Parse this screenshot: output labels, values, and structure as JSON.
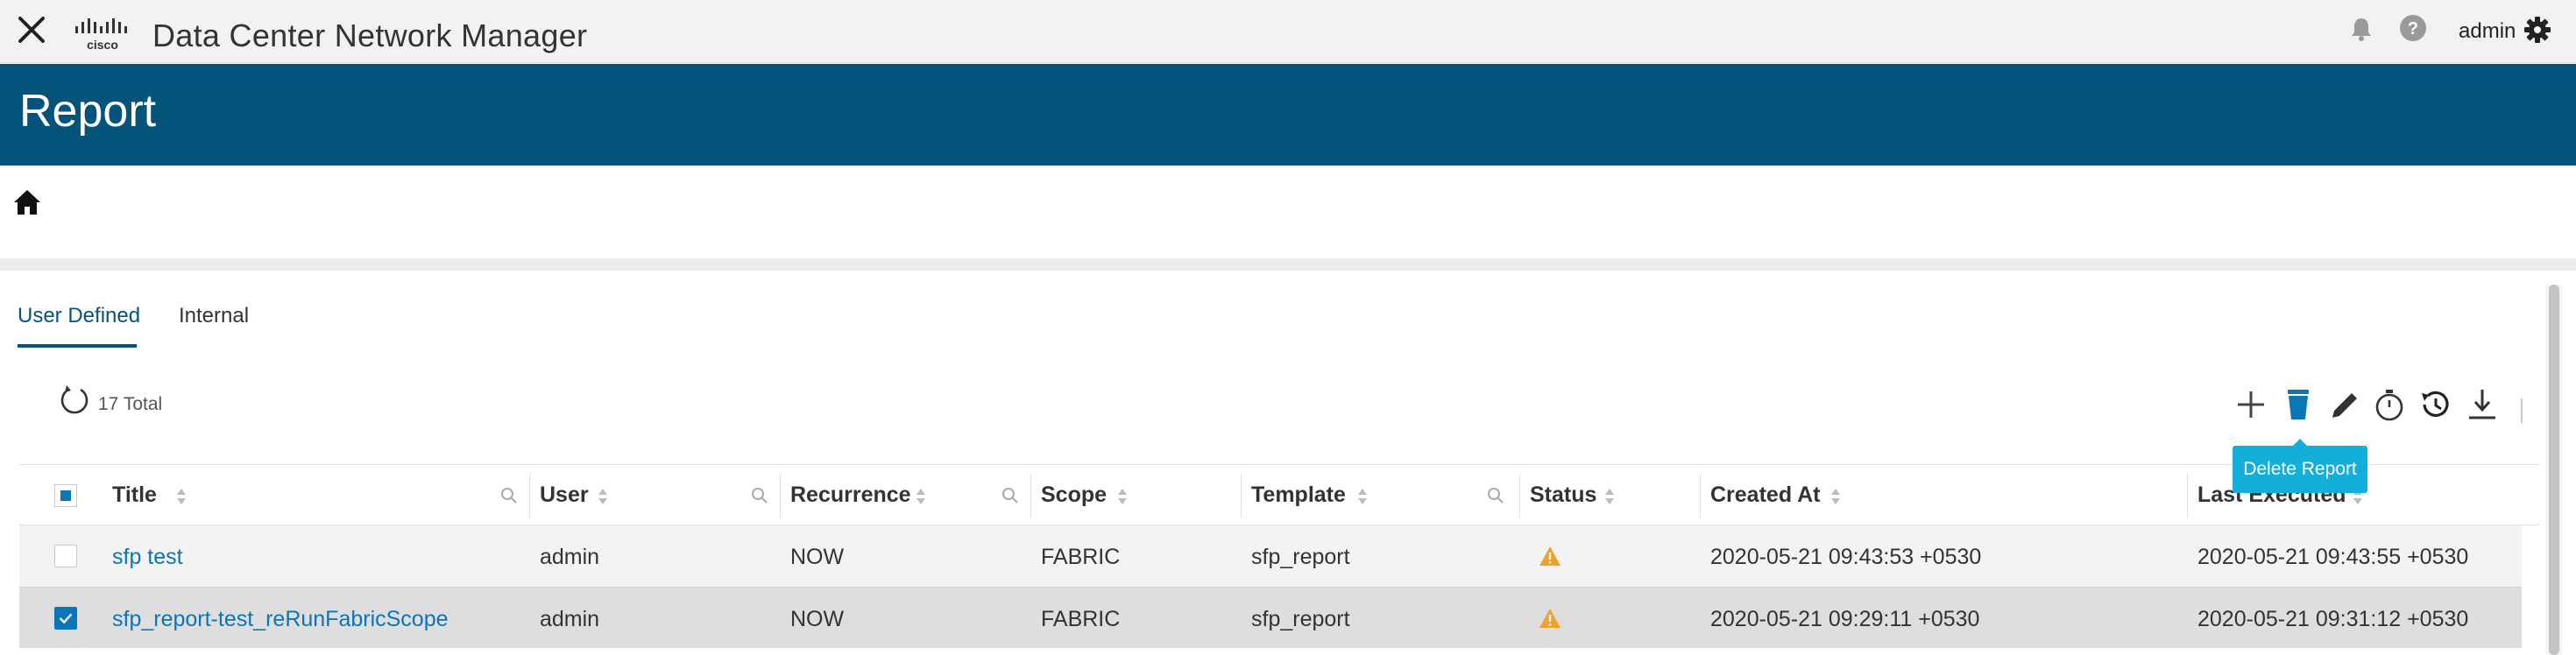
{
  "app": {
    "title": "Data Center Network Manager",
    "logo_text": "cisco",
    "user": "admin"
  },
  "page": {
    "title": "Report"
  },
  "tabs": [
    {
      "label": "User Defined",
      "active": true
    },
    {
      "label": "Internal",
      "active": false
    }
  ],
  "summary": {
    "total_text": "17 Total"
  },
  "toolbar": {
    "icons": [
      "add-icon",
      "delete-icon",
      "edit-icon",
      "timer-icon",
      "history-icon",
      "download-icon"
    ],
    "tooltip": "Delete Report"
  },
  "table": {
    "columns": [
      "Title",
      "User",
      "Recurrence",
      "Scope",
      "Template",
      "Status",
      "Created At",
      "Last Executed"
    ],
    "rows": [
      {
        "selected": false,
        "title": "sfp test",
        "user": "admin",
        "recurrence": "NOW",
        "scope": "FABRIC",
        "template": "sfp_report",
        "status": "warning",
        "created_at": "2020-05-21 09:43:53 +0530",
        "last_executed": "2020-05-21 09:43:55 +0530"
      },
      {
        "selected": true,
        "title": "sfp_report-test_reRunFabricScope",
        "user": "admin",
        "recurrence": "NOW",
        "scope": "FABRIC",
        "template": "sfp_report",
        "status": "warning",
        "created_at": "2020-05-21 09:29:11 +0530",
        "last_executed": "2020-05-21 09:31:12 +0530"
      }
    ]
  },
  "colors": {
    "header_bg": "#04537a",
    "link": "#0b76b5",
    "tooltip_bg": "#14aeda",
    "warning": "#f0a12b"
  }
}
